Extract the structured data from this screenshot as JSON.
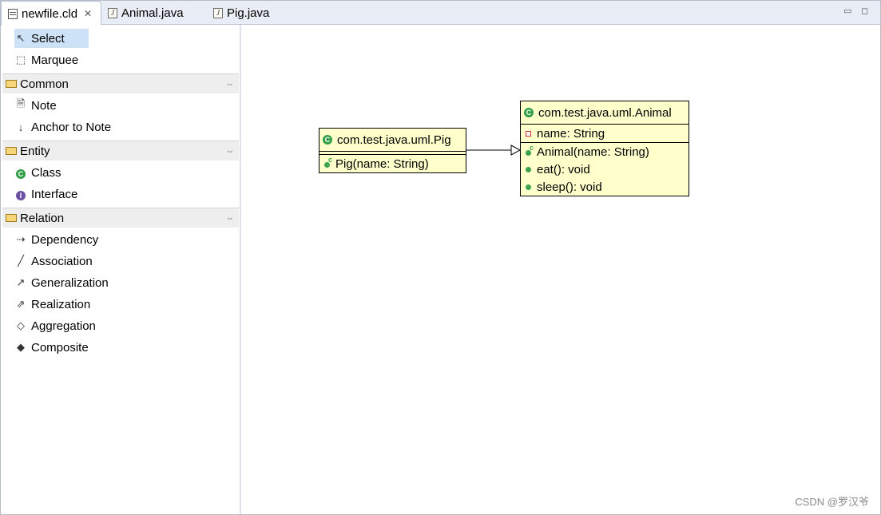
{
  "tabs": [
    {
      "label": "newfile.cld",
      "icon": "class-diagram-file-icon",
      "active": true
    },
    {
      "label": "Animal.java",
      "icon": "java-file-icon",
      "active": false
    },
    {
      "label": "Pig.java",
      "icon": "java-file-icon",
      "active": false
    }
  ],
  "tools": {
    "select": "Select",
    "marquee": "Marquee"
  },
  "drawers": {
    "common": {
      "label": "Common",
      "items": [
        "Note",
        "Anchor to Note"
      ]
    },
    "entity": {
      "label": "Entity",
      "items": [
        "Class",
        "Interface"
      ]
    },
    "relation": {
      "label": "Relation",
      "items": [
        "Dependency",
        "Association",
        "Generalization",
        "Realization",
        "Aggregation",
        "Composite"
      ]
    }
  },
  "diagram": {
    "pig": {
      "name": "com.test.java.uml.Pig",
      "methods": [
        "Pig(name: String)"
      ]
    },
    "animal": {
      "name": "com.test.java.uml.Animal",
      "attributes": [
        "name: String"
      ],
      "methods": [
        "Animal(name: String)",
        "eat(): void",
        "sleep(): void"
      ]
    },
    "relation": "generalization"
  },
  "watermark": "CSDN @罗汉爷",
  "colors": {
    "class_fill": "#ffffcc",
    "selection": "#cde1f7",
    "tab_bar": "#e9edf5"
  }
}
